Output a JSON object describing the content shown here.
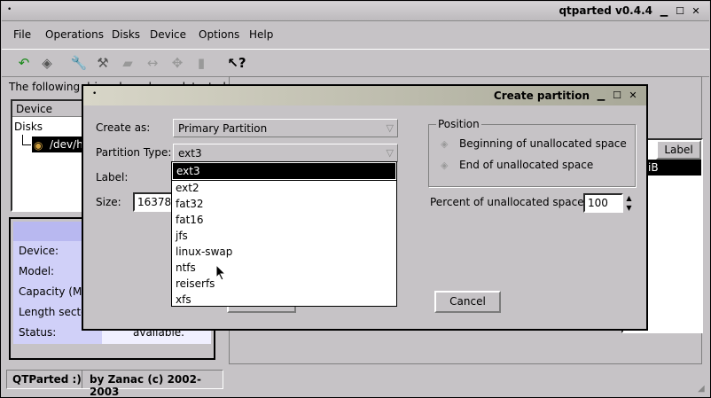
{
  "window": {
    "title": "qtparted v0.4.4"
  },
  "menu": [
    "File",
    "Operations",
    "Disks",
    "Device",
    "Options",
    "Help"
  ],
  "toolbar_icons": [
    "back-arrow-icon",
    "disk-icon",
    "wrench-icon",
    "hammer-icon",
    "eraser-icon",
    "resize-icon",
    "move-icon",
    "trash-icon",
    "whatsthis-icon"
  ],
  "left": {
    "detected_text": "The following drives have been detected",
    "col_device": "Device",
    "tree_root": "Disks",
    "tree_child": "/dev/hd"
  },
  "info": {
    "labels": [
      "Device:",
      "Model:",
      "Capacity (Mb",
      "Length secto",
      "Status:"
    ],
    "status_value": "available."
  },
  "right": {
    "col_label": "Label",
    "row_text": "iB"
  },
  "statusbar": {
    "left": "QTParted :)",
    "right": "by Zanac (c) 2002-2003"
  },
  "dialog": {
    "title": "Create partition",
    "create_as_label": "Create as:",
    "create_as_value": "Primary Partition",
    "ptype_label": "Partition Type:",
    "ptype_value": "ext3",
    "label_label": "Label:",
    "size_label": "Size:",
    "size_value": "16378.",
    "fs_options": [
      "ext3",
      "ext2",
      "fat32",
      "fat16",
      "jfs",
      "linux-swap",
      "ntfs",
      "reiserfs",
      "xfs"
    ],
    "position_title": "Position",
    "pos_begin": "Beginning of unallocated space",
    "pos_end": "End of unallocated space",
    "percent_label": "Percent of unallocated space:",
    "percent_value": "100",
    "cancel": "Cancel"
  }
}
